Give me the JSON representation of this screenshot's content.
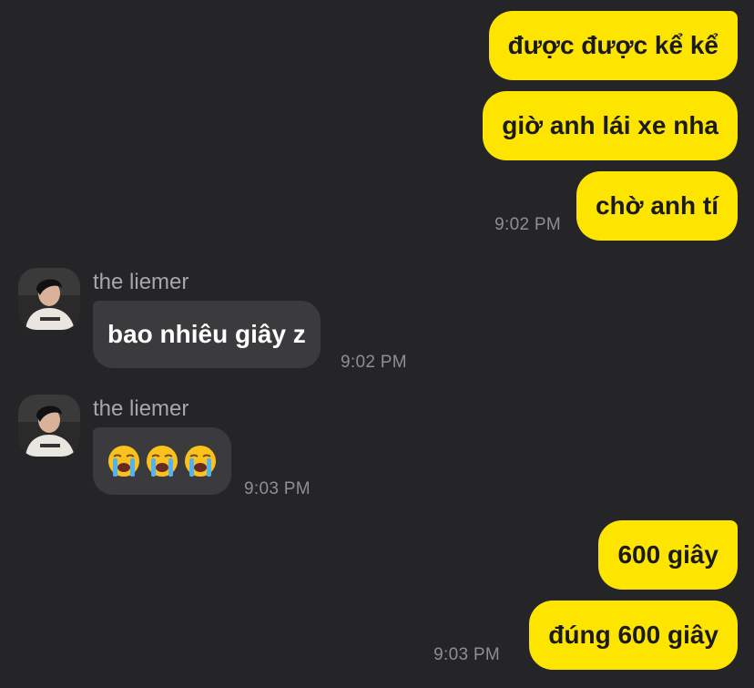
{
  "conversation": {
    "outgoing_group_1": {
      "messages": [
        "được được kể kể",
        "giờ anh lái xe nha",
        "chờ anh tí"
      ],
      "time": "9:02 PM"
    },
    "incoming_1": {
      "sender": "the liemer",
      "message": "bao nhiêu giây z",
      "time": "9:02 PM"
    },
    "incoming_2": {
      "sender": "the liemer",
      "emojis": [
        "loudly-crying-face",
        "loudly-crying-face",
        "loudly-crying-face"
      ],
      "time": "9:03 PM"
    },
    "outgoing_group_2": {
      "messages": [
        "600 giây",
        "đúng 600 giây"
      ],
      "time": "9:03 PM"
    }
  },
  "colors": {
    "background": "#252527",
    "outgoing_bubble": "#fee500",
    "incoming_bubble": "#3b3b3d",
    "timestamp": "#8e8e93"
  }
}
